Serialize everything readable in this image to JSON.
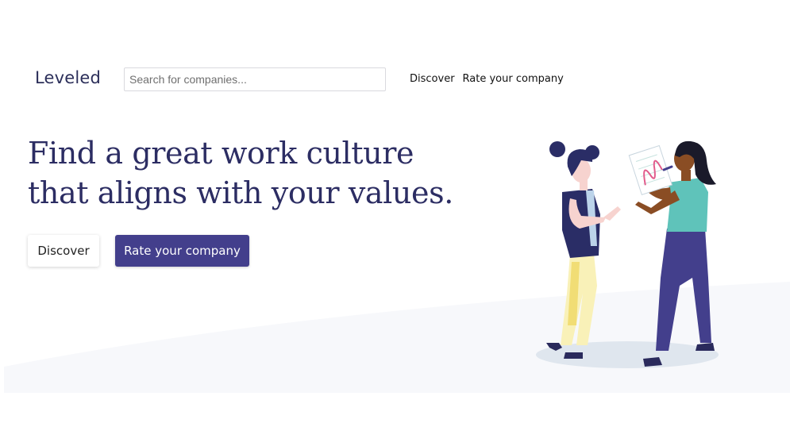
{
  "header": {
    "logo": "Leveled",
    "search": {
      "placeholder": "Search for companies...",
      "value": ""
    },
    "nav": [
      {
        "label": "Discover"
      },
      {
        "label": "Rate your company"
      }
    ]
  },
  "hero": {
    "headline_lines": [
      "Find a great work culture",
      "that aligns with your values."
    ],
    "buttons": {
      "discover_label": "Discover",
      "rate_label": "Rate your company"
    }
  },
  "colors": {
    "brand_navy": "#2c2d63",
    "primary_button": "#433f8c",
    "background_wave": "#f7f8fb"
  },
  "illustration": {
    "icon": "two-women-discussing-chart-illustration"
  }
}
